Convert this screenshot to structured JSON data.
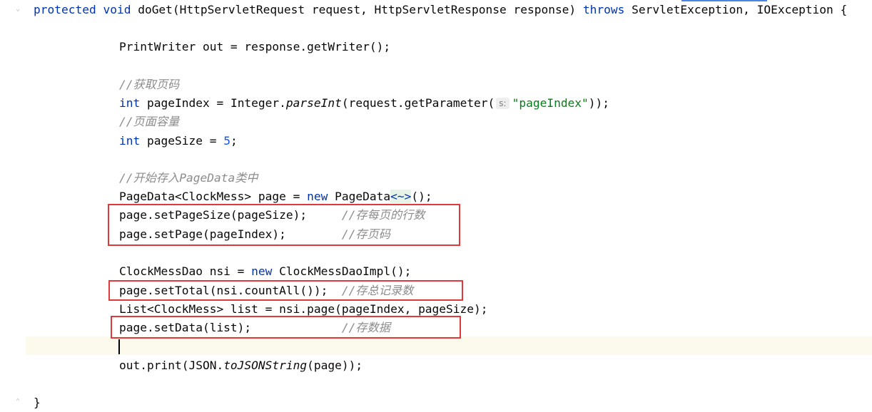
{
  "editor": {
    "lines": {
      "l1": {
        "kw1": "protected",
        "sp1": " ",
        "kw2": "void",
        "t1": " doGet(HttpServletRequest request, HttpServletResponse response) ",
        "kw3": "throws",
        "t2": " ServletException, IOException {"
      },
      "l2": {
        "t1": "PrintWriter out = response.getWriter();"
      },
      "l3": {
        "cm": "//获取页码"
      },
      "l4": {
        "kw": "int",
        "t1": " pageIndex = Integer.",
        "it": "parseInt",
        "t2": "(request.getParameter(",
        "hint": "s:",
        "str": "\"pageIndex\"",
        "t3": "));"
      },
      "l5": {
        "cm": "//页面容量"
      },
      "l6": {
        "kw": "int",
        "t1": " pageSize = ",
        "num": "5",
        "t2": ";"
      },
      "l7": {
        "cm": "//开始存入PageData类中"
      },
      "l8": {
        "t1": "PageData<ClockMess> page = ",
        "kw": "new",
        "t2": " PageData",
        "gen": "<~>",
        "t3": "();"
      },
      "l9": {
        "t1": "page.setPageSize(pageSize);     ",
        "cm": "//存每页的行数"
      },
      "l10": {
        "t1": "page.setPage(pageIndex);        ",
        "cm": "//存页码"
      },
      "l11": {
        "t1": "ClockMessDao nsi = ",
        "kw": "new",
        "t2": " ClockMessDaoImpl();"
      },
      "l12": {
        "t1": "page.setTotal(nsi.countAll());  ",
        "cm": "//存总记录数"
      },
      "l13": {
        "t1": "List<ClockMess> list = nsi.page(pageIndex, pageSize);"
      },
      "l14": {
        "t1": "page.setData(list);             ",
        "cm": "//存数据"
      },
      "l15": {
        "t1": "out.print(JSON.",
        "it": "toJSONString",
        "t2": "(page));"
      },
      "l16": {
        "t1": "}"
      }
    },
    "colors": {
      "keyword": "#0033b3",
      "string": "#067d17",
      "comment": "#8c8c8c",
      "number": "#1750eb",
      "highlight_box": "#e0383b"
    },
    "icons": {
      "fold_marker": "fold-marker-icon"
    }
  }
}
